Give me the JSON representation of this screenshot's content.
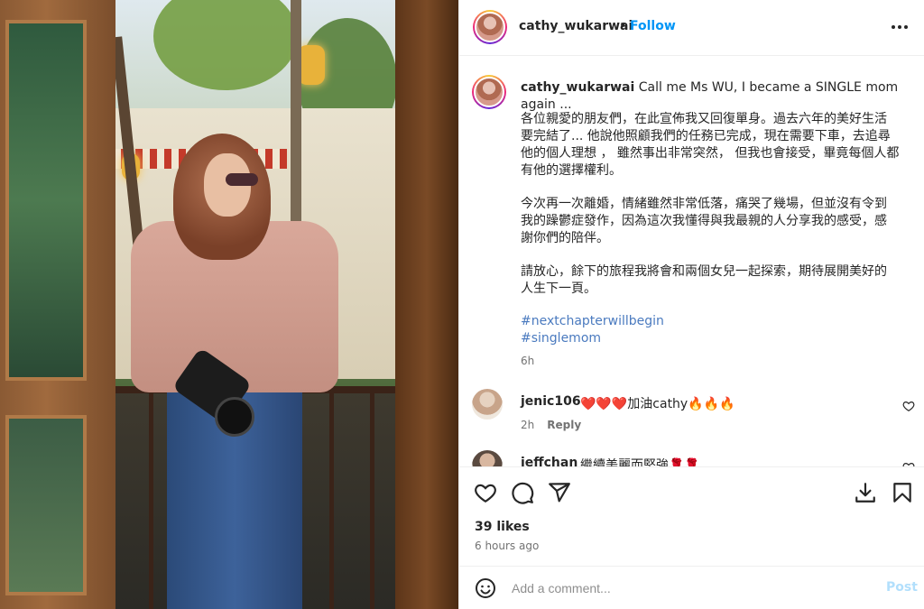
{
  "post": {
    "username": "cathy_wukarwai",
    "follow_label": "Follow",
    "dot": "•",
    "caption_title": "Call me Ms WU, I became a SINGLE mom again ...",
    "paragraph1": "各位親愛的朋友們，在此宣佈我又回復單身。過去六年的美好生活\n要完結了... 他說他照顧我們的任務已完成，現在需要下車，去追尋\n他的個人理想 ， 雖然事出非常突然， 但我也會接受，畢竟每個人都\n有他的選擇權利。",
    "paragraph2": "今次再一次離婚，情緒雖然非常低落，痛哭了幾場，但並沒有令到\n我的躁鬱症發作，因為這次我懂得與我最親的人分享我的感受，感\n謝你們的陪伴。",
    "paragraph3": "請放心，餘下的旅程我將會和兩個女兒一起探索，期待展開美好的\n人生下一頁。",
    "hashtags": [
      "#nextchapterwillbegin",
      "#singlemom"
    ],
    "caption_time": "6h"
  },
  "comments": [
    {
      "user": "jenic106",
      "text": "❤️❤️❤️加油cathy🔥🔥🔥",
      "time": "2h",
      "reply": "Reply"
    },
    {
      "user": "jeffchan",
      "text": "繼續美麗而堅強🌹🌹",
      "time": "",
      "reply": ""
    }
  ],
  "footer": {
    "likes": "39 likes",
    "ago": "6 hours ago",
    "comment_placeholder": "Add a comment...",
    "post_label": "Post"
  },
  "icons": {
    "more": "more-options-icon",
    "like": "heart-icon",
    "comment": "comment-icon",
    "share": "share-icon",
    "download": "download-icon",
    "save": "bookmark-icon",
    "emoji": "emoji-icon"
  }
}
